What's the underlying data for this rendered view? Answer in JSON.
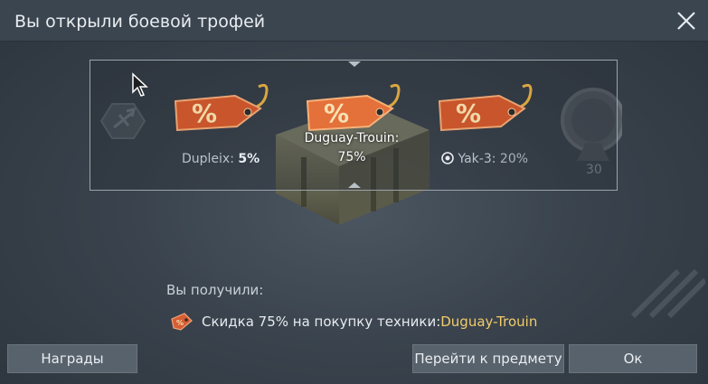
{
  "window": {
    "title": "Вы открыли боевой трофей"
  },
  "reel": {
    "items": [
      {
        "name": "Dupleix",
        "discount": "5%",
        "icon": "discount-tag-icon"
      },
      {
        "name": "Duguay-Trouin:",
        "discount": "75%",
        "icon": "discount-tag-icon"
      },
      {
        "name": "Yak-3",
        "discount": "20%",
        "icon": "discount-tag-icon",
        "prefix_icon": "target-icon"
      }
    ],
    "background_medal_text": "30"
  },
  "result": {
    "received_label": "Вы получили:",
    "reward_text": "Скидка 75% на покупку техники: ",
    "reward_vehicle": "Duguay-Trouin"
  },
  "buttons": {
    "awards": "Награды",
    "goto": "Перейти к предмету",
    "ok": "Ок"
  },
  "colors": {
    "accent_vehicle": "#f1cc6a",
    "tag_orange": "#d9653a"
  }
}
